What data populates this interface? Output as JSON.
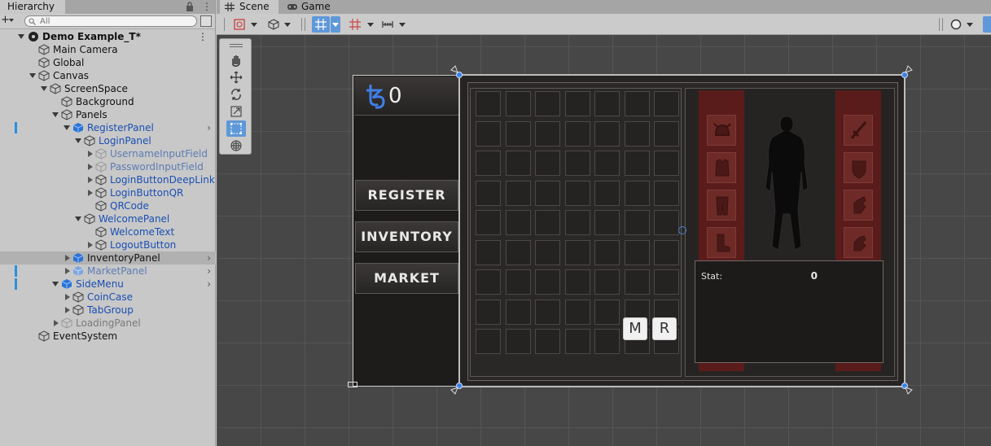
{
  "hierarchy": {
    "tab_label": "Hierarchy",
    "search_placeholder": "All",
    "rows": [
      {
        "label": "Demo Example_T*",
        "depth": 0
      },
      {
        "label": "Main Camera"
      },
      {
        "label": "Global"
      },
      {
        "label": "Canvas"
      },
      {
        "label": "ScreenSpace"
      },
      {
        "label": "Background"
      },
      {
        "label": "Panels"
      },
      {
        "label": "RegisterPanel"
      },
      {
        "label": "LoginPanel"
      },
      {
        "label": "UsernameInputField"
      },
      {
        "label": "PasswordInputField"
      },
      {
        "label": "LoginButtonDeepLink"
      },
      {
        "label": "LoginButtonQR"
      },
      {
        "label": "QRCode"
      },
      {
        "label": "WelcomePanel"
      },
      {
        "label": "WelcomeText"
      },
      {
        "label": "LogoutButton"
      },
      {
        "label": "InventoryPanel"
      },
      {
        "label": "MarketPanel"
      },
      {
        "label": "SideMenu"
      },
      {
        "label": "CoinCase"
      },
      {
        "label": "TabGroup"
      },
      {
        "label": "LoadingPanel"
      },
      {
        "label": "EventSystem"
      }
    ]
  },
  "scene": {
    "tabs": [
      {
        "label": "Scene"
      },
      {
        "label": "Game"
      }
    ]
  },
  "game_ui": {
    "coin_value": "0",
    "menu": [
      {
        "label": "REGISTER"
      },
      {
        "label": "INVENTORY"
      },
      {
        "label": "MARKET"
      }
    ],
    "stat_label": "Stat:",
    "stat_value": "0",
    "mini_buttons": [
      {
        "label": "M"
      },
      {
        "label": "R"
      }
    ]
  },
  "colors": {
    "selection_accent": "#2a8fe0",
    "prefab_text": "#1a4fb3",
    "equip_red": "#5a1c1a",
    "viewport_bg": "#474747"
  }
}
